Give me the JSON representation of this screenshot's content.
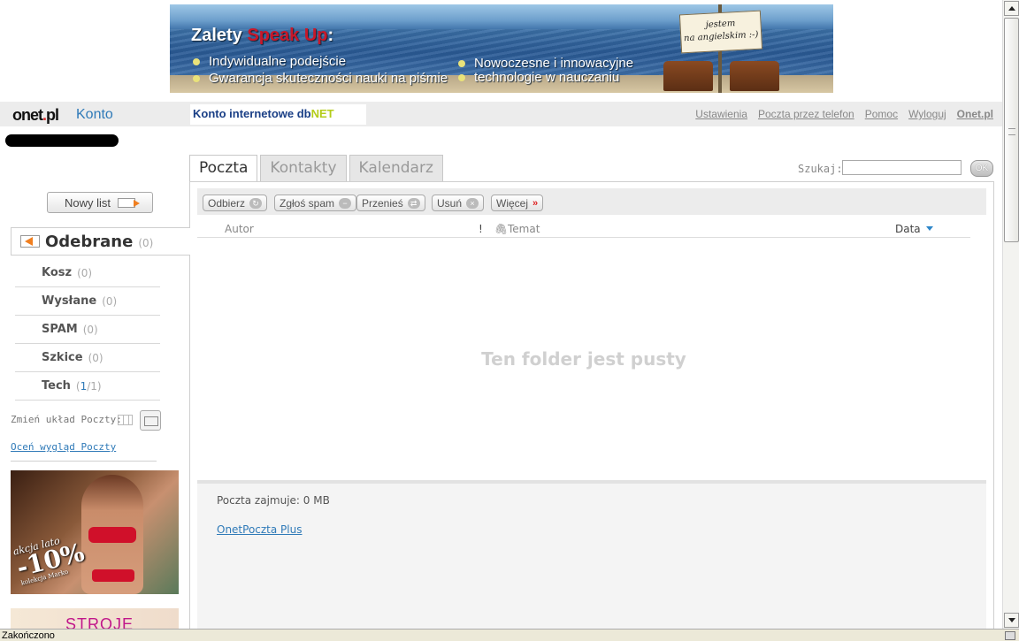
{
  "banner": {
    "title_prefix": "Zalety ",
    "title_accent": "Speak Up",
    "title_suffix": ":",
    "bullets": [
      "Indywidualne podejście",
      "Gwarancja skuteczności nauki na piśmie",
      "Nowoczesne i innowacyjne",
      "technologie w nauczaniu"
    ],
    "sign_line1": "jestem",
    "sign_line2": "na angielskim :-)"
  },
  "header": {
    "logo_main": "onet",
    "logo_dot": ".",
    "logo_tld": "pl",
    "konto": "Konto",
    "dbnet_prefix": "Konto internetowe db",
    "dbnet_suffix": "NET",
    "links": {
      "settings": "Ustawienia",
      "phone_mail": "Poczta przez telefon",
      "help": "Pomoc",
      "logout": "Wyloguj",
      "onet": "Onet.pl"
    }
  },
  "tabs": {
    "mail": "Poczta",
    "contacts": "Kontakty",
    "calendar": "Kalendarz"
  },
  "search": {
    "label": "Szukaj:",
    "value": "",
    "ok": "OK"
  },
  "toolbar": {
    "receive": "Odbierz",
    "spam": "Zgłoś spam",
    "move": "Przenieś",
    "delete": "Usuń",
    "more": "Więcej",
    "more_icon": "»"
  },
  "columns": {
    "author": "Autor",
    "priority": "!",
    "subject": "Temat",
    "date": "Data"
  },
  "message_list": {
    "empty": "Ten folder jest pusty"
  },
  "footer": {
    "quota": "Poczta zajmuje: 0 MB",
    "plus": "OnetPoczta Plus"
  },
  "sidebar": {
    "new_mail": "Nowy list",
    "inbox": {
      "name": "Odebrane",
      "count": "(0)"
    },
    "folders": [
      {
        "name": "Kosz",
        "count": "(0)"
      },
      {
        "name": "Wysłane",
        "count": "(0)"
      },
      {
        "name": "SPAM",
        "count": "(0)"
      },
      {
        "name": "Szkice",
        "count": "(0)"
      }
    ],
    "tech": {
      "name": "Tech",
      "open": "(",
      "unread": "1",
      "total": "/1)"
    },
    "layout_label": "Zmień układ Poczty:",
    "rate_link": "Oceń wygląd Poczty"
  },
  "ads": {
    "ad1_line1": "akcja lato",
    "ad1_line2": "-10%",
    "ad1_line3": "kolekcja Marko",
    "ad2_text": "STROJE"
  },
  "status": {
    "text": "Zakończono"
  }
}
